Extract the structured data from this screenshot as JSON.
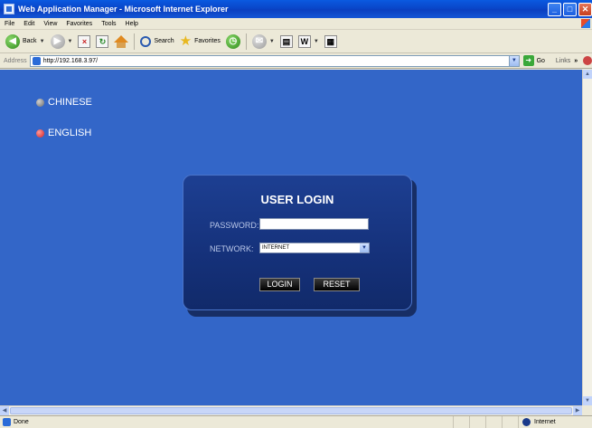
{
  "window": {
    "title": "Web Application Manager - Microsoft Internet Explorer",
    "minimize": "_",
    "maximize": "□"
  },
  "menu": [
    "File",
    "Edit",
    "View",
    "Favorites",
    "Tools",
    "Help"
  ],
  "toolbar": {
    "back_label": "Back",
    "search_label": "Search",
    "favorites_label": "Favorites"
  },
  "address": {
    "label": "Address",
    "url": "http://192.168.3.97/",
    "go_label": "Go",
    "links_label": "Links",
    "chevron": "»"
  },
  "languages": [
    {
      "label": "CHINESE",
      "selected": false
    },
    {
      "label": "ENGLISH",
      "selected": true
    }
  ],
  "login": {
    "title": "USER LOGIN",
    "password_label": "PASSWORD:",
    "password_value": "",
    "network_label": "NETWORK:",
    "network_selected": "INTERNET",
    "login_button": "LOGIN",
    "reset_button": "RESET"
  },
  "status": {
    "text": "Done",
    "zone": "Internet"
  },
  "colors": {
    "page_background": "#3366c8",
    "login_panel": "#15317a",
    "title_bar": "#0a47cc"
  }
}
